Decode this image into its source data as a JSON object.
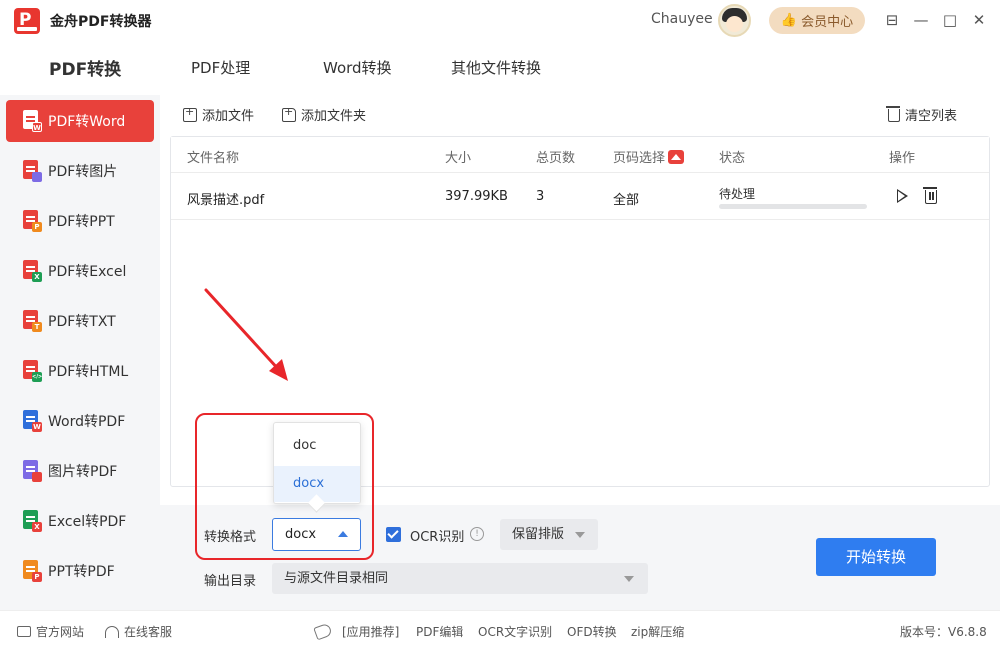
{
  "app": {
    "title": "金舟PDF转换器",
    "user": "Chauyee",
    "vip_label": "会员中心",
    "window": {
      "minimize": "—",
      "maximize": "□",
      "close": "✕",
      "skin": "⊟"
    }
  },
  "tabs": [
    {
      "label": "PDF转换",
      "active": true
    },
    {
      "label": "PDF处理",
      "active": false
    },
    {
      "label": "Word转换",
      "active": false
    },
    {
      "label": "其他文件转换",
      "active": false
    }
  ],
  "sidebar": {
    "items": [
      {
        "label": "PDF转Word",
        "badge": "W",
        "badge_color": "#e8413b",
        "active": true
      },
      {
        "label": "PDF转图片",
        "badge": "",
        "badge_color": "#7d6be5",
        "active": false
      },
      {
        "label": "PDF转PPT",
        "badge": "P",
        "badge_color": "#f08a1e",
        "active": false
      },
      {
        "label": "PDF转Excel",
        "badge": "X",
        "badge_color": "#1e9e55",
        "active": false
      },
      {
        "label": "PDF转TXT",
        "badge": "T",
        "badge_color": "#f08a1e",
        "active": false
      },
      {
        "label": "PDF转HTML",
        "badge": "</>",
        "badge_color": "#1e9e55",
        "active": false
      },
      {
        "label": "Word转PDF",
        "badge": "W",
        "badge_color": "#2f6fdb",
        "active": false
      },
      {
        "label": "图片转PDF",
        "badge": "",
        "badge_color": "#7d6be5",
        "active": false
      },
      {
        "label": "Excel转PDF",
        "badge": "X",
        "badge_color": "#1e9e55",
        "active": false
      },
      {
        "label": "PPT转PDF",
        "badge": "P",
        "badge_color": "#f08a1e",
        "active": false
      }
    ]
  },
  "toolbar": {
    "add_file": "添加文件",
    "add_folder": "添加文件夹",
    "clear_list": "清空列表"
  },
  "table": {
    "headers": [
      "文件名称",
      "大小",
      "总页数",
      "页码选择",
      "状态",
      "操作"
    ],
    "rows": [
      {
        "name": "风景描述.pdf",
        "size": "397.99KB",
        "pages": "3",
        "range": "全部",
        "status": "待处理",
        "progress": 0
      }
    ]
  },
  "format_dropdown": {
    "options": [
      "doc",
      "docx"
    ],
    "selected": "docx"
  },
  "settings": {
    "format_label": "转换格式",
    "format_value": "docx",
    "ocr_label": "OCR识别",
    "ocr_checked": true,
    "layout_value": "保留排版",
    "output_label": "输出目录",
    "output_value": "与源文件目录相同",
    "start_button": "开始转换"
  },
  "footer": {
    "website": "官方网站",
    "service": "在线客服",
    "app_rec": "[应用推荐]",
    "links": [
      "PDF编辑",
      "OCR文字识别",
      "OFD转换",
      "zip解压缩"
    ],
    "version": "版本号：V6.8.8"
  },
  "colors": {
    "brand_red": "#e8413b",
    "accent_blue": "#2f7df0",
    "annotation_red": "#e8262a"
  }
}
